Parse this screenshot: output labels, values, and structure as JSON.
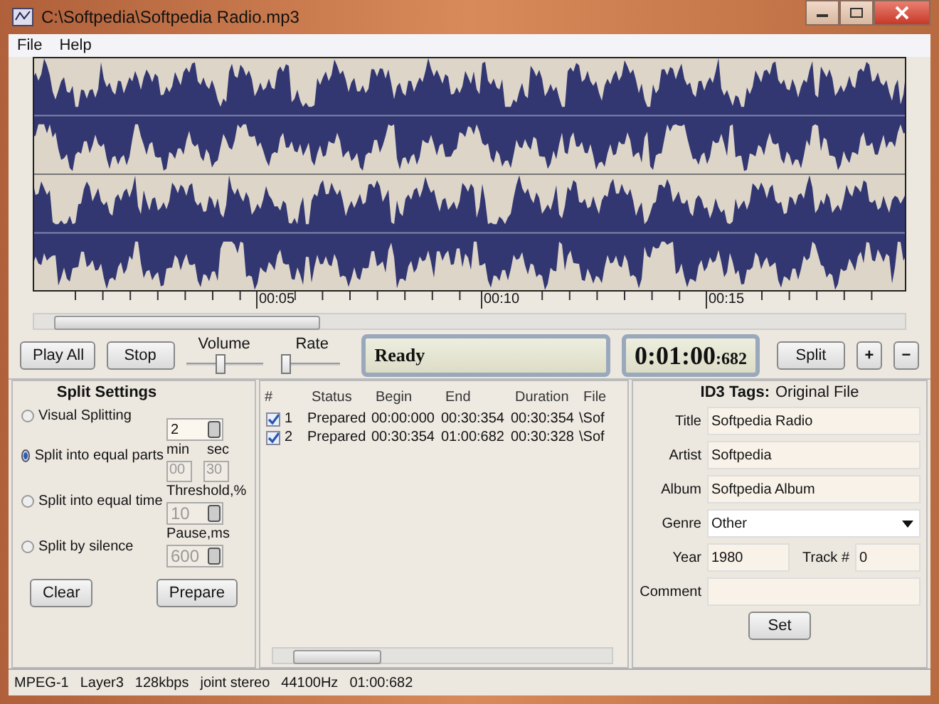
{
  "window": {
    "title": "C:\\Softpedia\\Softpedia Radio.mp3"
  },
  "menu": [
    "File",
    "Help"
  ],
  "waveform": {
    "time_labels": [
      "00:05",
      "00:10",
      "00:15"
    ]
  },
  "transport": {
    "play_all": "Play All",
    "stop": "Stop",
    "volume": {
      "label": "Volume",
      "level": 0.45
    },
    "rate": {
      "label": "Rate",
      "level": 0.05
    },
    "status": "Ready",
    "time_main": "0:01:00",
    "time_ms": ":682",
    "split": "Split",
    "plus": "+",
    "minus": "−"
  },
  "split_settings": {
    "title": "Split Settings",
    "options": [
      {
        "label": "Visual Splitting",
        "selected": false
      },
      {
        "label": "Split into equal parts",
        "selected": true
      },
      {
        "label": "Split into equal time",
        "selected": false
      },
      {
        "label": "Split by silence",
        "selected": false
      }
    ],
    "parts": {
      "value": "2",
      "disabled": false
    },
    "min_label": "min",
    "sec_label": "sec",
    "min": {
      "value": "00",
      "disabled": true
    },
    "sec": {
      "value": "30",
      "disabled": true
    },
    "threshold_label": "Threshold,%",
    "threshold": {
      "value": "10",
      "disabled": true
    },
    "pause_label": "Pause,ms",
    "pause": {
      "value": "600",
      "disabled": true
    },
    "buttons": [
      "Clear",
      "Prepare"
    ]
  },
  "table": {
    "columns": [
      "#",
      "Status",
      "Begin",
      "End",
      "Duration",
      "File"
    ],
    "rows": [
      {
        "checked": true,
        "cells": [
          "1",
          "Prepared",
          "00:00:000",
          "00:30:354",
          "00:30:354",
          "\\Sof"
        ]
      },
      {
        "checked": true,
        "cells": [
          "2",
          "Prepared",
          "00:30:354",
          "01:00:682",
          "00:30:328",
          "\\Sof"
        ]
      }
    ]
  },
  "id3": {
    "title": "ID3 Tags:",
    "subtitle": "Original File",
    "fields": [
      {
        "label": "Title",
        "value": "Softpedia Radio",
        "kind": "text"
      },
      {
        "label": "Artist",
        "value": "Softpedia",
        "kind": "text"
      },
      {
        "label": "Album",
        "value": "Softpedia Album",
        "kind": "text"
      },
      {
        "label": "Genre",
        "value": "Other",
        "kind": "select"
      }
    ],
    "year_label": "Year",
    "year": "1980",
    "track_label": "Track #",
    "track": "0",
    "comment_label": "Comment",
    "set": "Set"
  },
  "status_bar": [
    "MPEG-1",
    "Layer3",
    "128kbps",
    "joint stereo",
    "44100Hz",
    "01:00:682"
  ]
}
